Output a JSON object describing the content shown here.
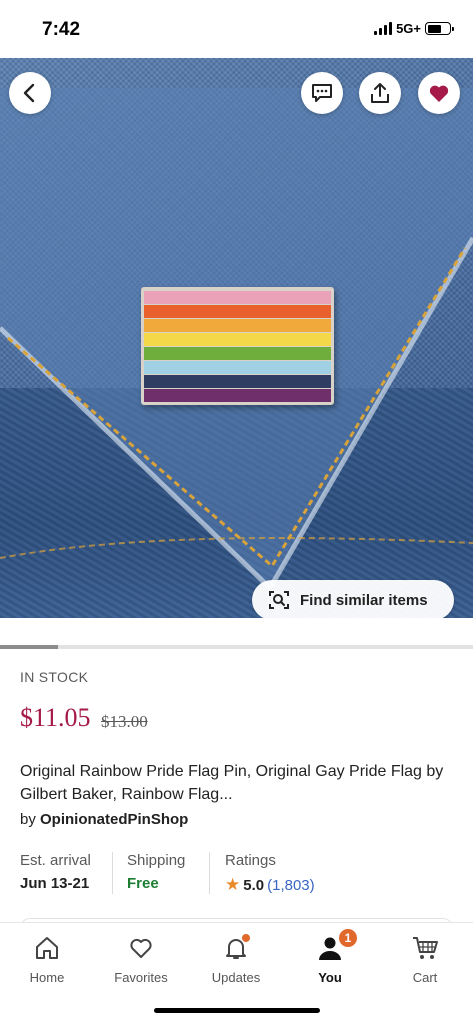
{
  "status_bar": {
    "time": "7:42",
    "network": "5G+",
    "battery_level": 0.62
  },
  "actions": {
    "back_icon": "chevron-left-icon",
    "message_icon": "message-icon",
    "share_icon": "share-icon",
    "favorite_icon": "heart-icon",
    "favorite_color": "#a61a4a"
  },
  "hero": {
    "find_similar_label": "Find similar items",
    "pin_stripes": [
      "#e9a2b8",
      "#e8612c",
      "#f0a93a",
      "#f5d74a",
      "#6fae3c",
      "#9fd0e3",
      "#2f3d63",
      "#6f2f6a"
    ]
  },
  "product": {
    "stock": "IN STOCK",
    "price": "$11.05",
    "original_price": "$13.00",
    "title": "Original Rainbow Pride Flag Pin, Original Gay Pride Flag by Gilbert Baker, Rainbow Flag...",
    "seller_prefix": "by",
    "seller": "OpinionatedPinShop",
    "price_color": "#a61a4a"
  },
  "details": {
    "arrival_label": "Est. arrival",
    "arrival_value": "Jun 13-21",
    "shipping_label": "Shipping",
    "shipping_value": "Free",
    "ratings_label": "Ratings",
    "rating_star": "★",
    "rating_value": "5.0",
    "rating_count": "(1,803)"
  },
  "nav": {
    "items": [
      {
        "label": "Home",
        "icon": "home-icon"
      },
      {
        "label": "Favorites",
        "icon": "heart-outline-icon"
      },
      {
        "label": "Updates",
        "icon": "bell-icon"
      },
      {
        "label": "You",
        "icon": "person-icon",
        "badge": "1"
      },
      {
        "label": "Cart",
        "icon": "cart-icon"
      }
    ],
    "accent_color": "#e0682a"
  }
}
